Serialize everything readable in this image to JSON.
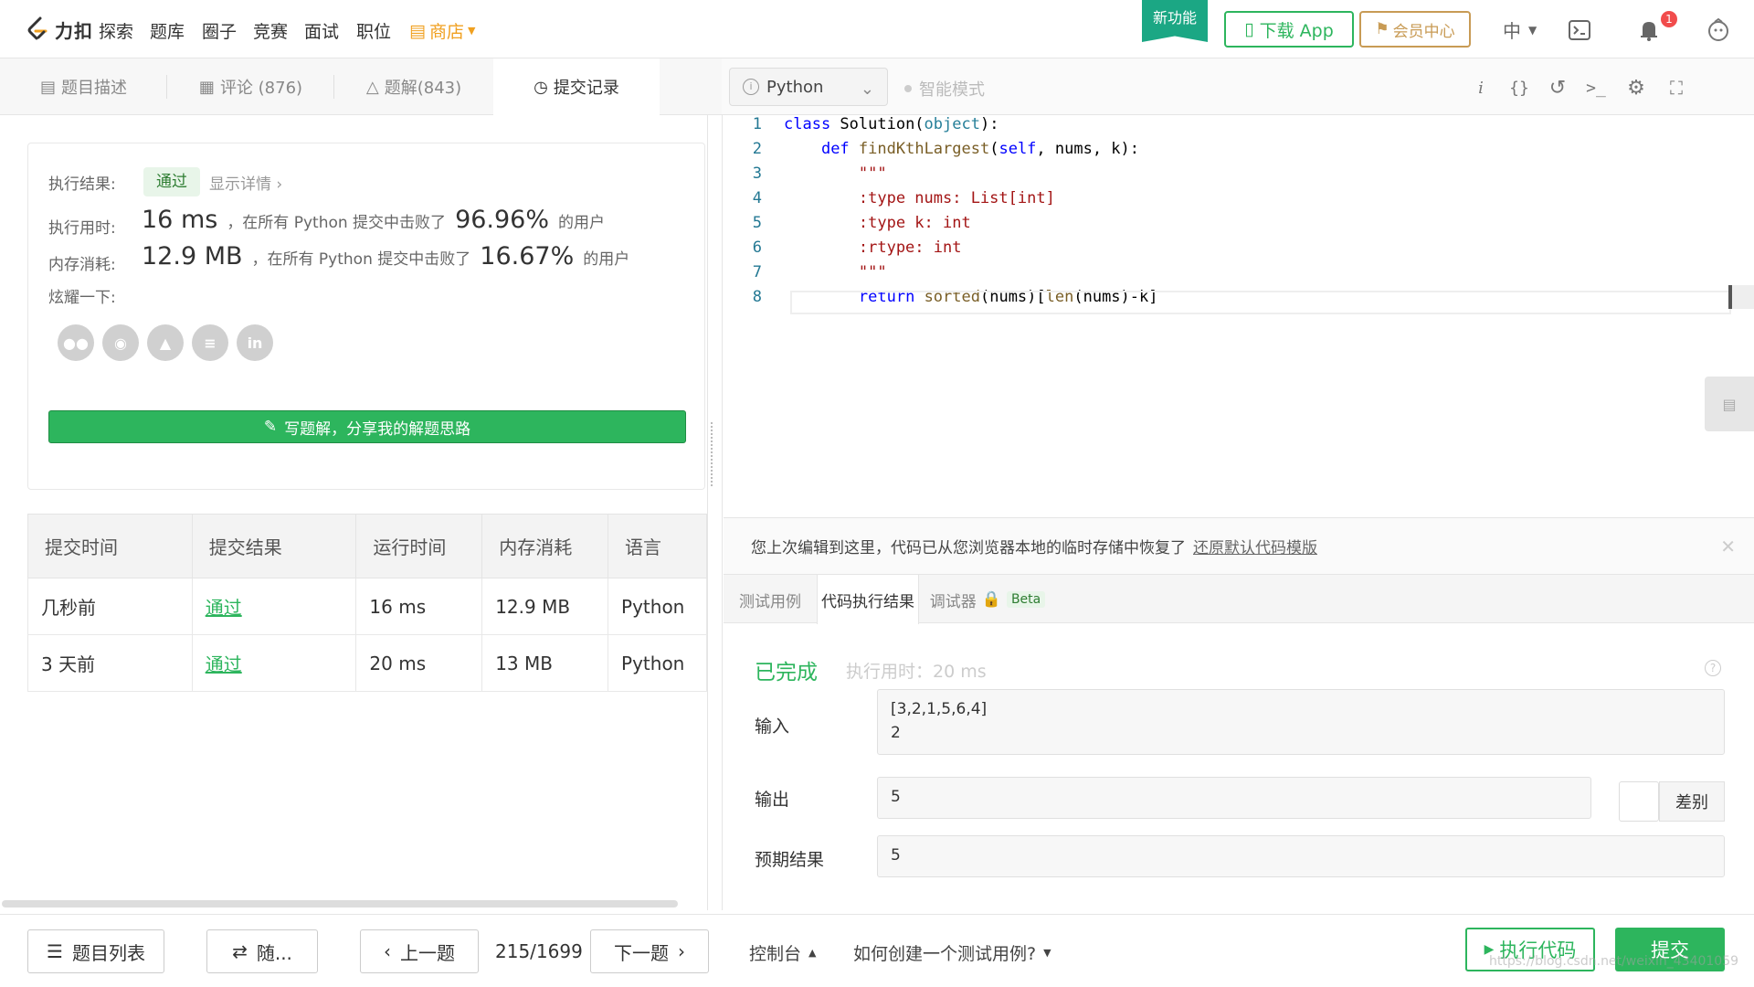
{
  "nav": {
    "brand": "力扣",
    "items": [
      "探索",
      "题库",
      "圈子",
      "竞赛",
      "面试",
      "职位"
    ],
    "store": "商店",
    "new_feature": "新功能",
    "download_app": "下载 App",
    "vip": "会员中心",
    "lang": "中",
    "notification_count": "1"
  },
  "tabs": [
    {
      "label": "题目描述",
      "icon": "description-icon"
    },
    {
      "label": "评论 (876)",
      "icon": "comment-icon"
    },
    {
      "label": "题解(843)",
      "icon": "flask-icon"
    },
    {
      "label": "提交记录",
      "icon": "clock-icon"
    }
  ],
  "editor": {
    "language": "Python",
    "smart_mode": "智能模式",
    "code_lines": [
      "class Solution(object):",
      "    def findKthLargest(self, nums, k):",
      "        \"\"\"",
      "        :type nums: List[int]",
      "        :type k: int",
      "        :rtype: int",
      "        \"\"\"",
      "        return sorted(nums)[len(nums)-k]"
    ]
  },
  "result": {
    "result_label": "执行结果:",
    "status": "通过",
    "detail_link": "显示详情",
    "time_label": "执行用时:",
    "time_value": "16 ms",
    "time_text": "，在所有 Python 提交中击败了",
    "time_percent": "96.96%",
    "time_suffix": "的用户",
    "mem_label": "内存消耗:",
    "mem_value": "12.9 MB",
    "mem_text": "，在所有 Python 提交中击败了",
    "mem_percent": "16.67%",
    "mem_suffix": "的用户",
    "share_label": "炫耀一下:",
    "write_button": "写题解，分享我的解题思路"
  },
  "submissions": {
    "headers": [
      "提交时间",
      "提交结果",
      "运行时间",
      "内存消耗",
      "语言"
    ],
    "rows": [
      [
        "几秒前",
        "通过",
        "16 ms",
        "12.9 MB",
        "Python"
      ],
      [
        "3 天前",
        "通过",
        "20 ms",
        "13 MB",
        "Python"
      ]
    ]
  },
  "restore_bar": {
    "message": "您上次编辑到这里，代码已从您浏览器本地的临时存储中恢复了",
    "link": "还原默认代码模版"
  },
  "console": {
    "tabs": [
      "测试用例",
      "代码执行结果",
      "调试器"
    ],
    "beta": "Beta",
    "status": "已完成",
    "runtime": "执行用时：20 ms",
    "input_label": "输入",
    "input_value": "[3,2,1,5,6,4]\n2",
    "output_label": "输出",
    "output_value": "5",
    "diff_label": "差别",
    "expected_label": "预期结果",
    "expected_value": "5"
  },
  "bottom": {
    "problem_list": "题目列表",
    "random": "随...",
    "prev": "上一题",
    "page": "215/1699",
    "next": "下一题",
    "console": "控制台",
    "howto": "如何创建一个测试用例?",
    "run": "执行代码",
    "submit": "提交",
    "watermark": "https://blog.csdn.net/weixin_43401059"
  }
}
